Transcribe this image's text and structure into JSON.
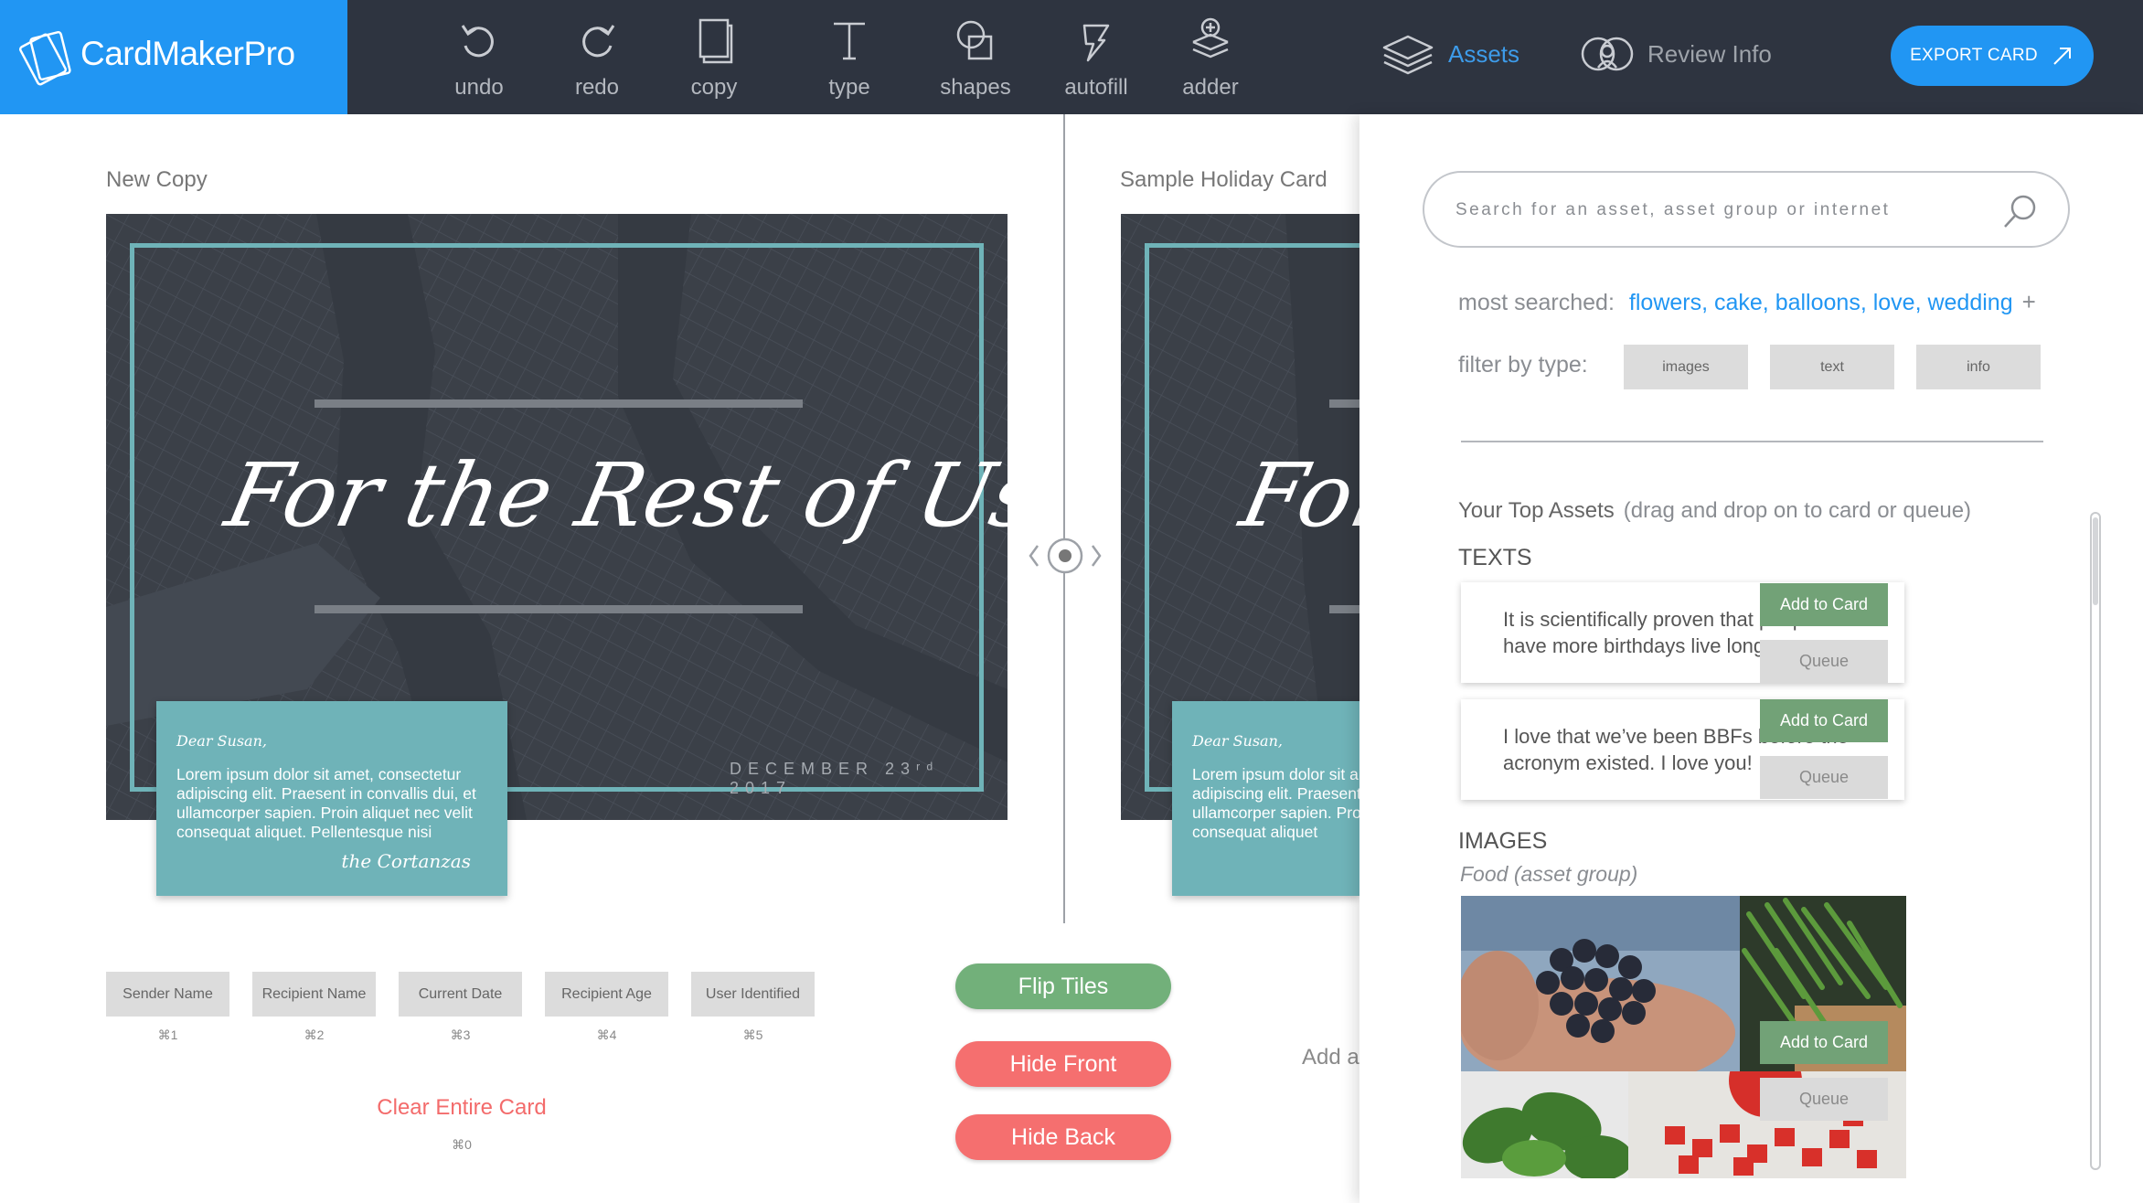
{
  "app": {
    "name": "CardMakerPro"
  },
  "toolbar": {
    "tools": [
      {
        "label": "undo",
        "icon": "undo-icon"
      },
      {
        "label": "redo",
        "icon": "redo-icon"
      },
      {
        "label": "copy",
        "icon": "copy-icon"
      },
      {
        "label": "type",
        "icon": "type-icon"
      },
      {
        "label": "shapes",
        "icon": "shapes-icon"
      },
      {
        "label": "autofill",
        "icon": "autofill-icon"
      },
      {
        "label": "adder",
        "icon": "adder-icon"
      }
    ],
    "nav": {
      "assets": "Assets",
      "review": "Review Info"
    },
    "export_label": "EXPORT CARD"
  },
  "workspace": {
    "left_card": {
      "title": "New Copy",
      "headline": "For the Rest of Us",
      "date": "DECEMBER 23ʳᵈ 2017",
      "salutation": "Dear Susan,",
      "body": "Lorem ipsum dolor sit amet, consectetur adipiscing elit. Praesent in convallis dui, et ullamcorper sapien. Proin aliquet nec velit consequat aliquet. Pellentesque nisi",
      "signature": "the Cortanzas"
    },
    "right_card": {
      "title": "Sample Holiday Card",
      "headline": "For",
      "salutation": "Dear Susan,",
      "body": "Lorem ipsum dolor sit amet, consectetur adipiscing elit. Praesent in convallis dui, et ullamcorper sapien. Proin aliquet nec velit consequat aliquet"
    },
    "variables": [
      {
        "label": "Sender Name",
        "shortcut": "⌘1"
      },
      {
        "label": "Recipient Name",
        "shortcut": "⌘2"
      },
      {
        "label": "Current Date",
        "shortcut": "⌘3"
      },
      {
        "label": "Recipient Age",
        "shortcut": "⌘4"
      },
      {
        "label": "User Identified",
        "shortcut": "⌘5"
      }
    ],
    "clear": {
      "label": "Clear Entire Card",
      "shortcut": "⌘0"
    },
    "actions": {
      "flip": "Flip Tiles",
      "hide_front": "Hide Front",
      "hide_back": "Hide Back"
    },
    "add_hint": "Add a"
  },
  "assets": {
    "search": {
      "placeholder": "Search for an asset, asset group or internet",
      "value": ""
    },
    "most_searched": {
      "label": "most searched:",
      "terms": "flowers, cake, balloons, love, wedding",
      "more": "+"
    },
    "filter": {
      "label": "filter by type:",
      "types": [
        "images",
        "text",
        "info"
      ]
    },
    "top_assets": {
      "title": "Your Top Assets",
      "hint": "(drag and drop on to card or queue)"
    },
    "texts": {
      "heading": "TEXTS",
      "items": [
        "It is scientifically proven that people who have more birthdays live longer.",
        "I love that we’ve been BBFs before the acronym existed. I love you!"
      ]
    },
    "images": {
      "heading": "IMAGES",
      "group": "Food (asset group)"
    },
    "buttons": {
      "add": "Add to Card",
      "queue": "Queue"
    }
  },
  "colors": {
    "topbar": "#2e3440",
    "brand_blue": "#2196f3",
    "teal": "#6fb3b8",
    "green": "#72a277",
    "red": "#f56f6f"
  }
}
